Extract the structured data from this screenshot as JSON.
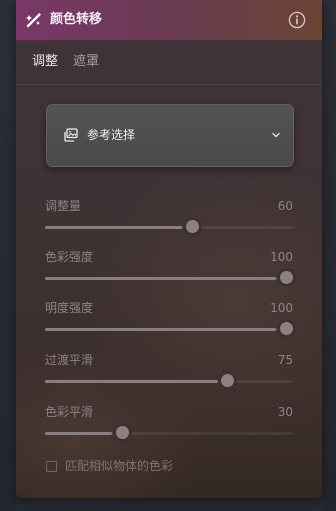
{
  "panel": {
    "title": "颜色转移",
    "title_icon": "magic-wand-icon",
    "info_icon": "info-icon"
  },
  "tabs": [
    {
      "label": "调整",
      "active": true
    },
    {
      "label": "遮罩",
      "active": false
    }
  ],
  "reference": {
    "label": "参考选择",
    "icon": "image-gallery-icon",
    "dropdown_icon": "chevron-down-icon"
  },
  "sliders": [
    {
      "label": "调整量",
      "value": "60",
      "fraction": 0.6
    },
    {
      "label": "色彩强度",
      "value": "100",
      "fraction": 1.0
    },
    {
      "label": "明度强度",
      "value": "100",
      "fraction": 1.0
    },
    {
      "label": "过渡平滑",
      "value": "75",
      "fraction": 0.75
    },
    {
      "label": "色彩平滑",
      "value": "30",
      "fraction": 0.3
    }
  ],
  "checkbox": {
    "label": "匹配相似物体的色彩",
    "checked": false
  },
  "colors": {
    "title_bar_start": "#7a3868",
    "title_bar_end": "#6b4434",
    "panel_bg": "#3d3236",
    "slider_fill": "#8a7f80"
  }
}
